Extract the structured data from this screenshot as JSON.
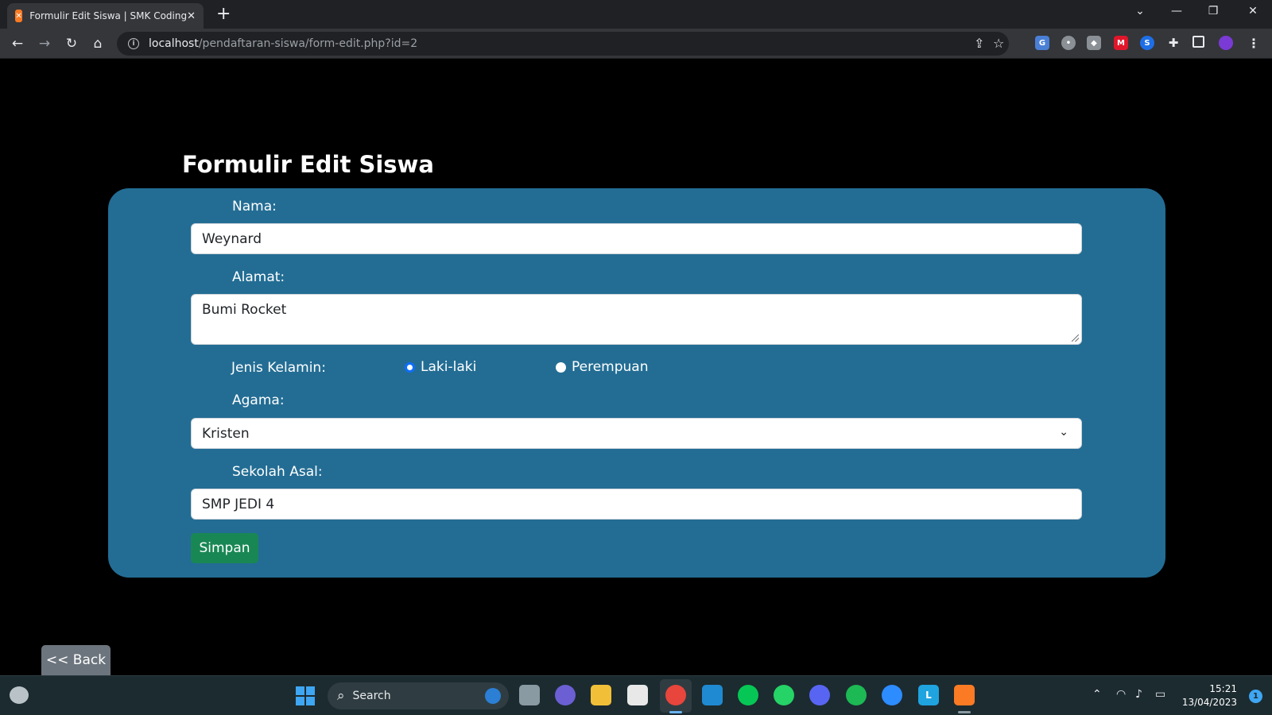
{
  "browser": {
    "tab_title": "Formulir Edit Siswa | SMK Coding",
    "tab_favicon": "xampp-icon",
    "url_host": "localhost",
    "url_path": "/pendaftaran-siswa/form-edit.php?id=2"
  },
  "page": {
    "title": "Formulir Edit Siswa",
    "back_label": "<< Back"
  },
  "form": {
    "nama_label": "Nama:",
    "nama_value": "Weynard",
    "alamat_label": "Alamat:",
    "alamat_value": "Bumi Rocket",
    "jk_label": "Jenis Kelamin:",
    "jk_options": [
      {
        "label": "Laki-laki",
        "checked": true
      },
      {
        "label": "Perempuan",
        "checked": false
      }
    ],
    "agama_label": "Agama:",
    "agama_value": "Kristen",
    "sekolah_label": "Sekolah Asal:",
    "sekolah_value": "SMP JEDI 4",
    "submit_label": "Simpan"
  },
  "taskbar": {
    "search_label": "Search",
    "time": "15:21",
    "date": "13/04/2023",
    "notification_count": "1"
  },
  "colors": {
    "card_bg": "#236d94",
    "save_button": "#198754",
    "back_button": "#6c757d"
  }
}
